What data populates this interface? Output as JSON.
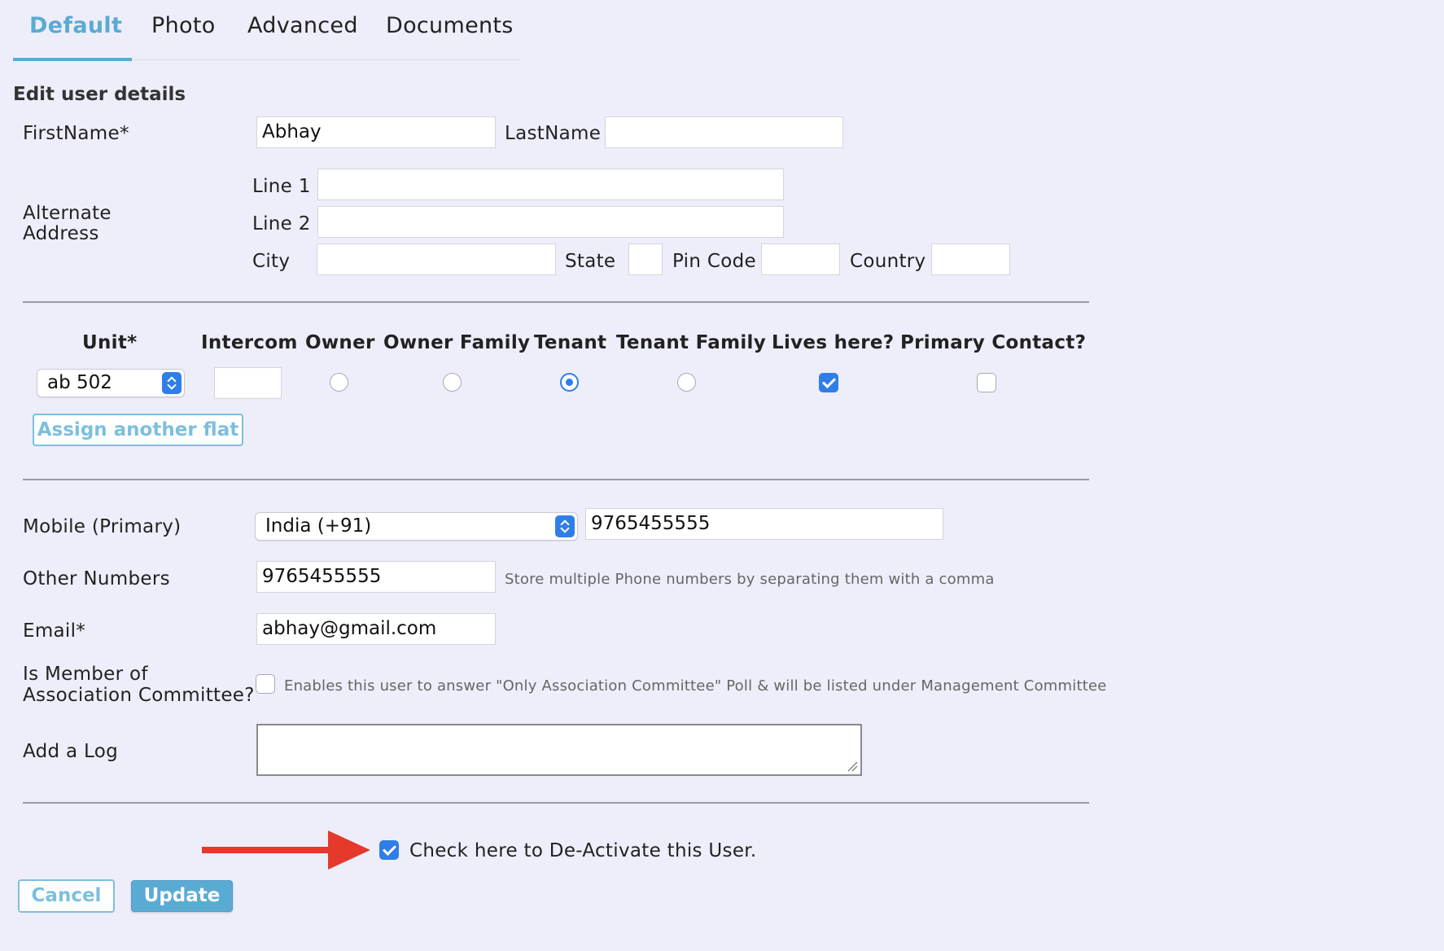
{
  "tabs": [
    {
      "label": "Default",
      "active": true
    },
    {
      "label": "Photo",
      "active": false
    },
    {
      "label": "Advanced",
      "active": false
    },
    {
      "label": "Documents",
      "active": false
    }
  ],
  "section_title": "Edit user details",
  "name": {
    "first_label": "FirstName*",
    "first_value": "Abhay",
    "last_label": "LastName",
    "last_value": ""
  },
  "address": {
    "label_line1": "Alternate",
    "label_line2": "Address",
    "line1_label": "Line 1",
    "line1_value": "",
    "line2_label": "Line 2",
    "line2_value": "",
    "city_label": "City",
    "city_value": "",
    "state_label": "State",
    "state_value": "",
    "pin_label": "Pin Code",
    "pin_value": "",
    "country_label": "Country",
    "country_value": ""
  },
  "unit_table": {
    "headers": [
      "Unit*",
      "Intercom",
      "Owner",
      "Owner Family",
      "Tenant",
      "Tenant Family",
      "Lives here?",
      "Primary Contact?"
    ],
    "unit_value": "ab 502",
    "intercom_value": "",
    "role_selected": "Tenant",
    "lives_here": true,
    "primary_contact": false,
    "assign_button": "Assign another flat"
  },
  "mobile": {
    "label": "Mobile (Primary)",
    "country_value": "India (+91)",
    "number_value": "9765455555"
  },
  "other_numbers": {
    "label": "Other Numbers",
    "value": "9765455555",
    "hint": "Store multiple Phone numbers by separating them with a comma"
  },
  "email": {
    "label": "Email*",
    "value": "abhay@gmail.com"
  },
  "committee": {
    "label_line1": "Is Member of",
    "label_line2": "Association Committee?",
    "checked": false,
    "hint": "Enables this user to answer \"Only Association Committee\" Poll & will be listed under Management Committee"
  },
  "log": {
    "label": "Add a Log",
    "value": ""
  },
  "deactivate": {
    "checked": true,
    "label": "Check here to De-Activate this User."
  },
  "buttons": {
    "cancel": "Cancel",
    "update": "Update"
  },
  "colors": {
    "accent": "#5aabd4",
    "checkbox_blue": "#2f7ee8",
    "arrow_red": "#e5392b",
    "background": "#eeeefb"
  }
}
